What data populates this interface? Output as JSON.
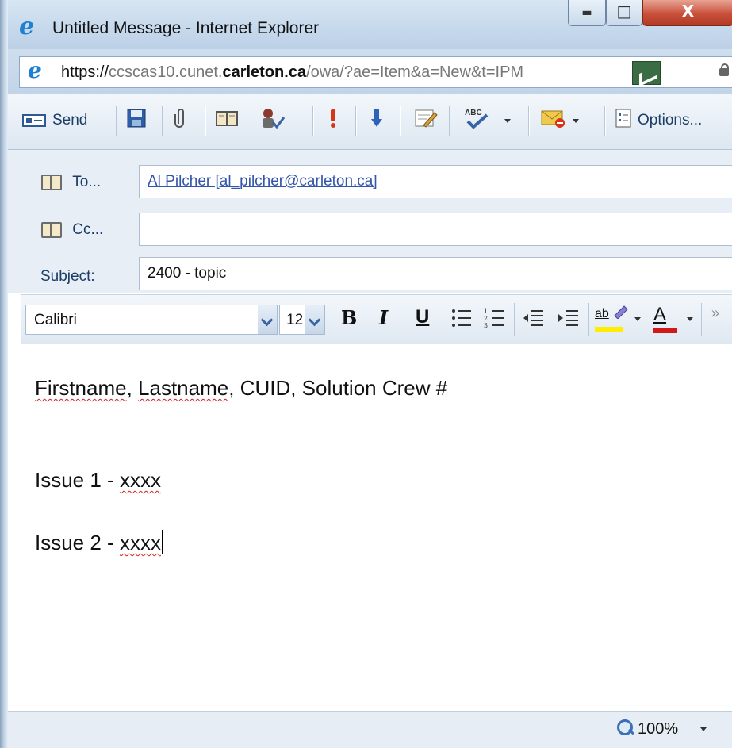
{
  "window": {
    "title": "Untitled Message - Internet Explorer",
    "minimize_glyph": "▭",
    "maximize_glyph": "□",
    "close_glyph": "X"
  },
  "address": {
    "scheme": "https://",
    "host_pre": "ccscas10.cunet.",
    "host_bold": "carleton.ca",
    "path": "/owa/?ae=Item&a=New&t=IPM"
  },
  "toolbar": {
    "send_label": "Send",
    "options_label": "Options..."
  },
  "fields": {
    "to_label": "To...",
    "to_value": "Al Pilcher [al_pilcher@carleton.ca]",
    "cc_label": "Cc...",
    "cc_value": "",
    "subject_label": "Subject:",
    "subject_value": "2400 - topic"
  },
  "format": {
    "font": "Calibri",
    "size": "12",
    "bold": "B",
    "italic": "I",
    "underline": "U",
    "font_color_glyph": "A",
    "highlight_glyph": "ab"
  },
  "body": {
    "line1_a": "Firstname",
    "line1_b": ", ",
    "line1_c": "Lastname",
    "line1_d": ", CUID, Solution Crew #",
    "line2_a": "Issue 1 - ",
    "line2_b": "xxxx",
    "line3_a": "Issue 2 - ",
    "line3_b": "xxxx"
  },
  "status": {
    "zoom": "100%"
  },
  "colors": {
    "accent": "#1f7fd1",
    "link": "#3355aa",
    "close_button": "#c9503a",
    "spell_error": "#d02020"
  }
}
